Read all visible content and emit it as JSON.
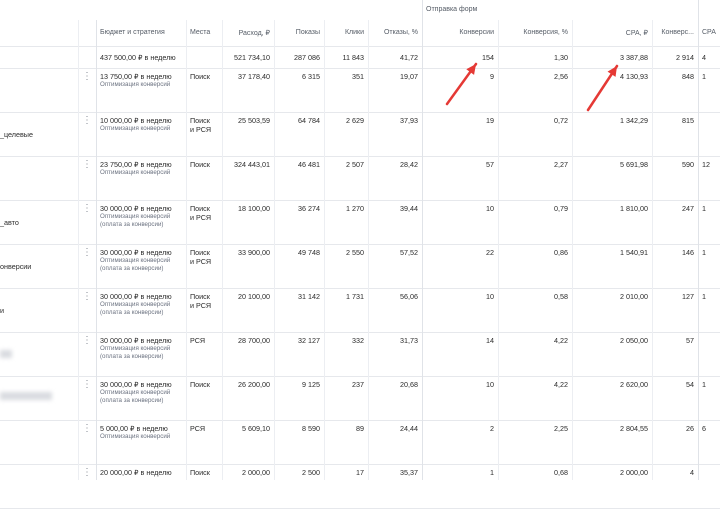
{
  "header": {
    "group_label": "Отправка форм",
    "columns": {
      "budget": "Бюджет и стратегия",
      "places": "Места",
      "spend": "Расход, ₽",
      "impressions": "Показы",
      "clicks": "Клики",
      "bounces": "Отказы, %",
      "conversions": "Конверсии",
      "conv_rate": "Конверсия, %",
      "cpa": "CPA, ₽",
      "conversions2": "Конверс...",
      "cpa2": "CPA"
    }
  },
  "totals": {
    "budget": "437 500,00 ₽ в неделю",
    "spend": "521 734,10",
    "impressions": "287 086",
    "clicks": "11 843",
    "bounces": "41,72",
    "conversions": "154",
    "conv_rate": "1,30",
    "cpa": "3 387,88",
    "conversions2": "2 914",
    "cpa2": "4"
  },
  "rows": [
    {
      "name": "",
      "budget": "13 750,00 ₽ в неделю",
      "strategy": [
        "Оптимизация конверсий"
      ],
      "places": [
        "Поиск"
      ],
      "spend": "37 178,40",
      "impressions": "6 315",
      "clicks": "351",
      "bounces": "19,07",
      "conversions": "9",
      "conv_rate": "2,56",
      "cpa": "4 130,93",
      "conversions2": "848",
      "cpa2": "1"
    },
    {
      "name": "_целевые",
      "budget": "10 000,00 ₽ в неделю",
      "strategy": [
        "Оптимизация конверсий"
      ],
      "places": [
        "Поиск",
        "и РСЯ"
      ],
      "spend": "25 503,59",
      "impressions": "64 784",
      "clicks": "2 629",
      "bounces": "37,93",
      "conversions": "19",
      "conv_rate": "0,72",
      "cpa": "1 342,29",
      "conversions2": "815",
      "cpa2": ""
    },
    {
      "name": "",
      "budget": "23 750,00 ₽ в неделю",
      "strategy": [
        "Оптимизация конверсий"
      ],
      "places": [
        "Поиск"
      ],
      "spend": "324 443,01",
      "impressions": "46 481",
      "clicks": "2 507",
      "bounces": "28,42",
      "conversions": "57",
      "conv_rate": "2,27",
      "cpa": "5 691,98",
      "conversions2": "590",
      "cpa2": "12"
    },
    {
      "name": "_авто",
      "budget": "30 000,00 ₽ в неделю",
      "strategy": [
        "Оптимизация конверсий",
        "(оплата за конверсии)"
      ],
      "places": [
        "Поиск",
        "и РСЯ"
      ],
      "spend": "18 100,00",
      "impressions": "36 274",
      "clicks": "1 270",
      "bounces": "39,44",
      "conversions": "10",
      "conv_rate": "0,79",
      "cpa": "1 810,00",
      "conversions2": "247",
      "cpa2": "1"
    },
    {
      "name": "онверсии",
      "budget": "30 000,00 ₽ в неделю",
      "strategy": [
        "Оптимизация конверсий",
        "(оплата за конверсии)"
      ],
      "places": [
        "Поиск",
        "и РСЯ"
      ],
      "spend": "33 900,00",
      "impressions": "49 748",
      "clicks": "2 550",
      "bounces": "57,52",
      "conversions": "22",
      "conv_rate": "0,86",
      "cpa": "1 540,91",
      "conversions2": "146",
      "cpa2": "1"
    },
    {
      "name": "и",
      "budget": "30 000,00 ₽ в неделю",
      "strategy": [
        "Оптимизация конверсий",
        "(оплата за конверсии)"
      ],
      "places": [
        "Поиск",
        "и РСЯ"
      ],
      "spend": "20 100,00",
      "impressions": "31 142",
      "clicks": "1 731",
      "bounces": "56,06",
      "conversions": "10",
      "conv_rate": "0,58",
      "cpa": "2 010,00",
      "conversions2": "127",
      "cpa2": "1"
    },
    {
      "name": "",
      "budget": "30 000,00 ₽ в неделю",
      "strategy": [
        "Оптимизация конверсий",
        "(оплата за конверсии)"
      ],
      "places": [
        "РСЯ"
      ],
      "spend": "28 700,00",
      "impressions": "32 127",
      "clicks": "332",
      "bounces": "31,73",
      "conversions": "14",
      "conv_rate": "4,22",
      "cpa": "2 050,00",
      "conversions2": "57",
      "cpa2": ""
    },
    {
      "name": "",
      "budget": "30 000,00 ₽ в неделю",
      "strategy": [
        "Оптимизация конверсий",
        "(оплата за конверсии)"
      ],
      "places": [
        "Поиск"
      ],
      "spend": "26 200,00",
      "impressions": "9 125",
      "clicks": "237",
      "bounces": "20,68",
      "conversions": "10",
      "conv_rate": "4,22",
      "cpa": "2 620,00",
      "conversions2": "54",
      "cpa2": "1"
    },
    {
      "name": "",
      "budget": "5 000,00 ₽ в неделю",
      "strategy": [
        "Оптимизация конверсий"
      ],
      "places": [
        "РСЯ"
      ],
      "spend": "5 609,10",
      "impressions": "8 590",
      "clicks": "89",
      "bounces": "24,44",
      "conversions": "2",
      "conv_rate": "2,25",
      "cpa": "2 804,55",
      "conversions2": "26",
      "cpa2": "6"
    },
    {
      "name": "",
      "budget": "20 000,00 ₽ в неделю",
      "strategy": [],
      "places": [
        "Поиск"
      ],
      "spend": "2 000,00",
      "impressions": "2 500",
      "clicks": "17",
      "bounces": "35,37",
      "conversions": "1",
      "conv_rate": "0,68",
      "cpa": "2 000,00",
      "conversions2": "4",
      "cpa2": ""
    }
  ],
  "colors": {
    "arrow": "#e53935",
    "border": "#e6e8ec",
    "muted_text": "#6b7280"
  },
  "icons": {
    "row_menu": "vertical-dots-icon",
    "annotation": "red-arrow-icon"
  }
}
